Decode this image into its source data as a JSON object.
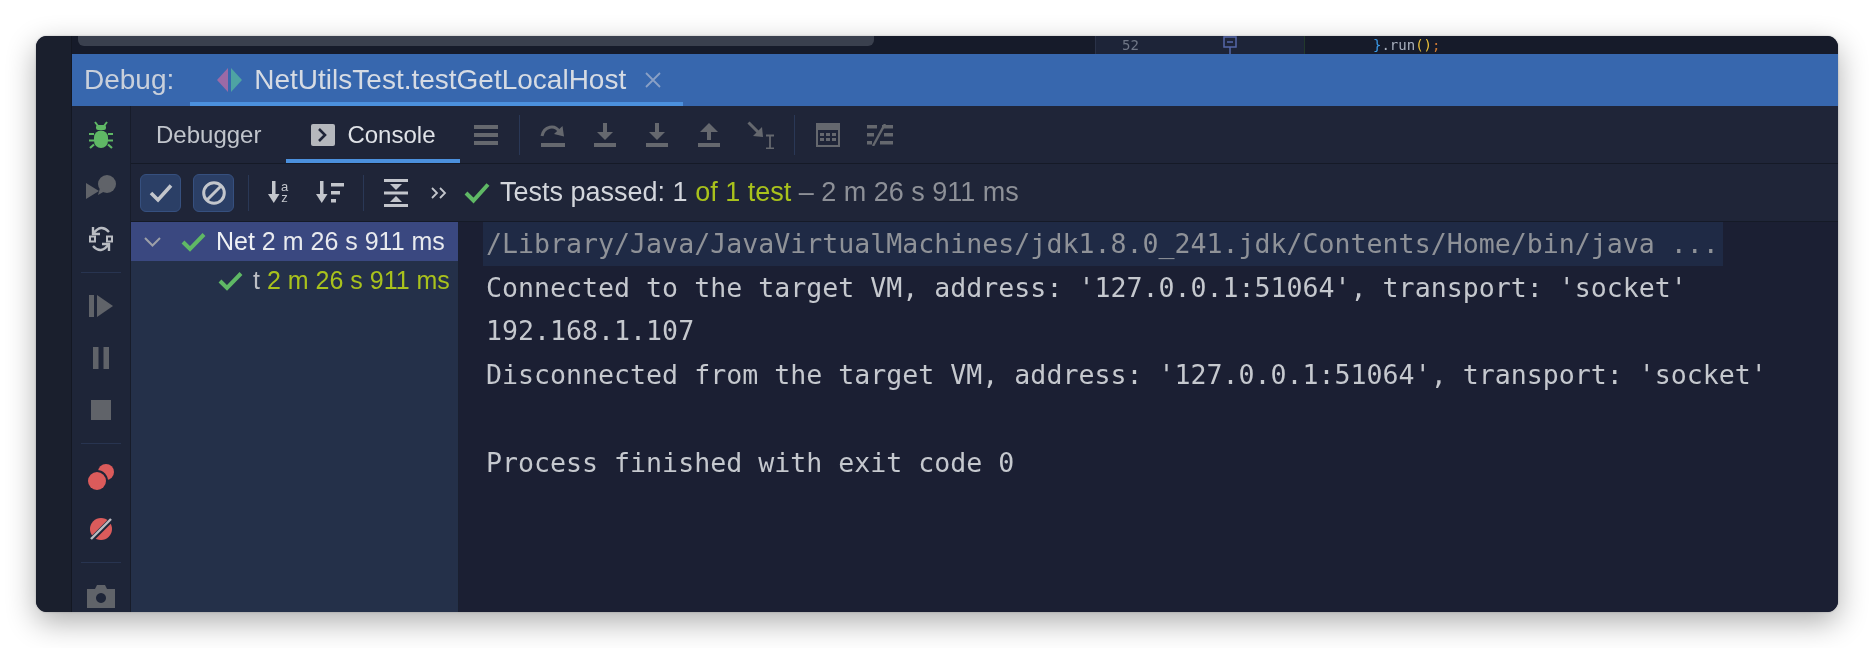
{
  "editor": {
    "line_number": "52",
    "code": [
      {
        "kind": "brace",
        "text": "}"
      },
      {
        "kind": "method",
        "text": ".run"
      },
      {
        "kind": "paren",
        "text": "()"
      },
      {
        "kind": "punct",
        "text": ";"
      }
    ]
  },
  "debug_bar": {
    "title": "Debug:",
    "sessions": [
      {
        "label": "NetUtilsTest.testGetLocalHost",
        "selected": true
      }
    ]
  },
  "side_toolbar": [
    [
      {
        "kind": "rerun",
        "disabled": false
      },
      {
        "kind": "rerun_failed",
        "disabled": true
      },
      {
        "kind": "restore_layout",
        "disabled": false
      }
    ],
    [
      {
        "kind": "resume",
        "disabled": true
      },
      {
        "kind": "pause",
        "disabled": true
      },
      {
        "kind": "stop",
        "disabled": true
      }
    ],
    [
      {
        "kind": "view_breakpoints",
        "disabled": false
      },
      {
        "kind": "mute_breakpoints",
        "disabled": false
      }
    ],
    [
      {
        "kind": "thread_dump",
        "disabled": true
      }
    ]
  ],
  "tabs": [
    {
      "label": "Debugger",
      "kind": "plain",
      "selected": false
    },
    {
      "label": "Console",
      "kind": "console",
      "selected": true
    }
  ],
  "step_toolbar": [
    [
      {
        "kind": "layout",
        "disabled": true
      }
    ],
    [
      {
        "kind": "step_over",
        "disabled": true
      },
      {
        "kind": "step_into",
        "disabled": true
      },
      {
        "kind": "force_step_into",
        "disabled": true
      },
      {
        "kind": "step_out",
        "disabled": true
      },
      {
        "kind": "run_to_cursor",
        "disabled": true
      }
    ],
    [
      {
        "kind": "evaluate",
        "disabled": true
      },
      {
        "kind": "trace",
        "disabled": true
      }
    ]
  ],
  "test_toolbar": {
    "filters": [
      {
        "kind": "passed",
        "selected": true
      },
      {
        "kind": "ignored",
        "selected": true
      }
    ],
    "sorts": [
      {
        "kind": "alphabetical",
        "selected": false,
        "letters": [
          "a",
          "z"
        ]
      },
      {
        "kind": "duration",
        "selected": false
      }
    ]
  },
  "test_status": {
    "passed": "Tests passed: 1",
    "total": "of 1 test",
    "duration": "– 2 m 26 s 911 ms"
  },
  "test_tree": [
    {
      "name": "Net",
      "time": "2 m 26 s 911 ms",
      "passed": true,
      "expanded": true,
      "selected": true,
      "children": [
        {
          "name": "t",
          "time": "2 m 26 s 911 ms",
          "passed": true,
          "selected": false
        }
      ]
    }
  ],
  "console": [
    {
      "kind": "command",
      "text": "/Library/Java/JavaVirtualMachines/jdk1.8.0_241.jdk/Contents/Home/bin/java ..."
    },
    {
      "kind": "output",
      "text": "Connected to the target VM, address: '127.0.0.1:51064', transport: 'socket'"
    },
    {
      "kind": "output",
      "text": "192.168.1.107"
    },
    {
      "kind": "output",
      "text": "Disconnected from the target VM, address: '127.0.0.1:51064', transport: 'socket'"
    },
    {
      "kind": "exit",
      "text": "Process finished with exit code 0"
    }
  ]
}
